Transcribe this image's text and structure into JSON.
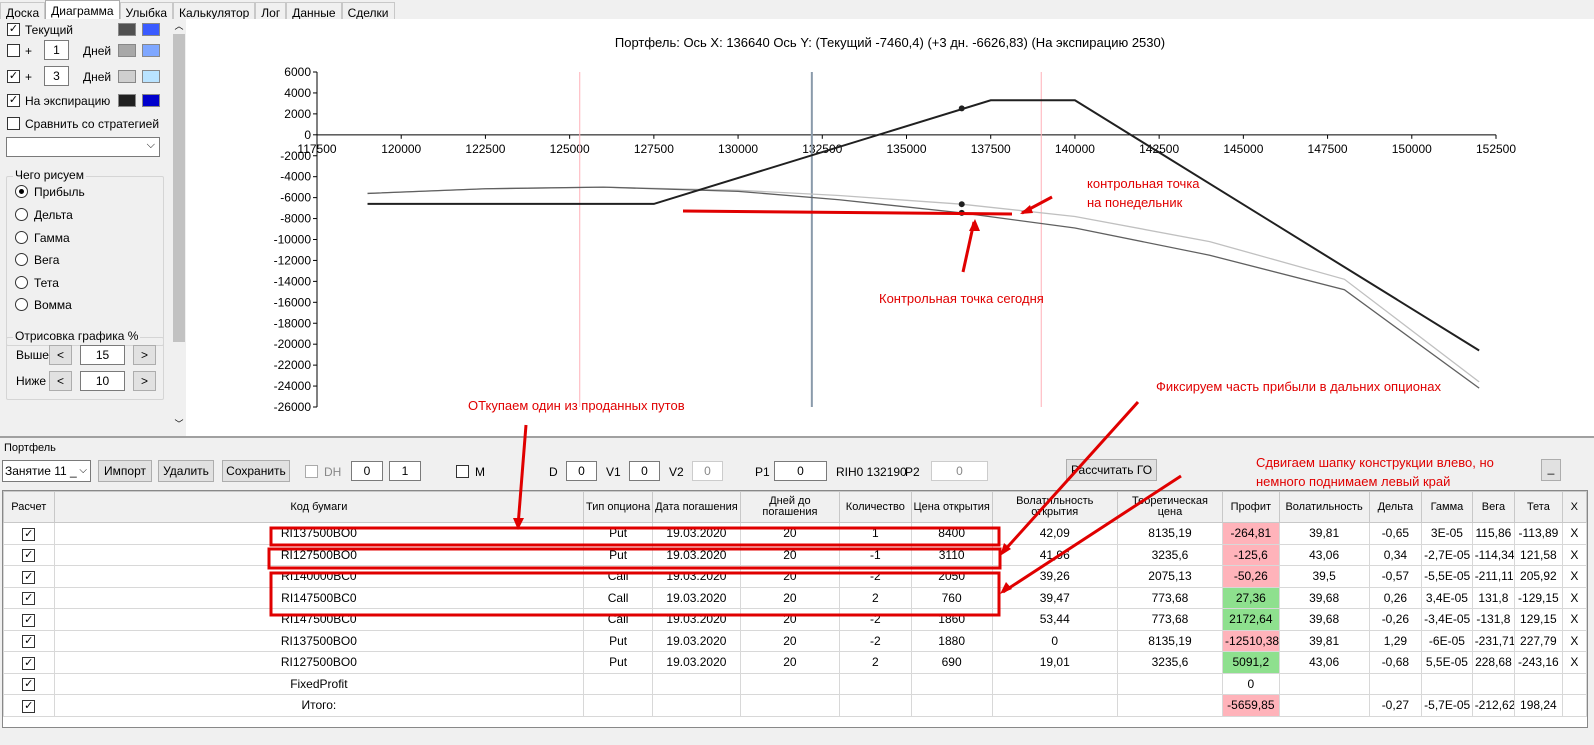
{
  "tabs": [
    "Доска",
    "Диаграмма",
    "Улыбка",
    "Калькулятор",
    "Лог",
    "Данные",
    "Сделки"
  ],
  "left": {
    "current_label": "Текущий",
    "plus1": "+",
    "plus1_days": "1",
    "days1": "Дней",
    "plus2": "+",
    "plus2_days": "3",
    "days2": "Дней",
    "expiry_label": "На экспирацию",
    "compare_label": "Сравнить со стратегией",
    "what_title": "Чего рисуем",
    "radios": [
      "Прибыль",
      "Дельта",
      "Гамма",
      "Вега",
      "Тета",
      "Вомма"
    ],
    "draw_title": "Отрисовка графика %",
    "above_label": "Выше",
    "above_value": "15",
    "below_label": "Ниже",
    "below_value": "10",
    "colors": {
      "current": [
        "#505050",
        "#3a5bff"
      ],
      "plus1": [
        "#a8a8a8",
        "#7fa7ff"
      ],
      "plus3": [
        "#cfcfcf",
        "#b9e3ff"
      ],
      "expiry": [
        "#202020",
        "#0000cc"
      ]
    }
  },
  "chart_data": {
    "type": "line",
    "title": "Портфель: Ось X:  136640 Ось Y:   (Текущий -7460,4)  (+3 дн. -6626,83)  (На экспирацию 2530)",
    "xlim": [
      117500,
      152500
    ],
    "ylim": [
      -26000,
      6000
    ],
    "x_ticks": [
      "117500",
      "120000",
      "122500",
      "125000",
      "127500",
      "130000",
      "132500",
      "135000",
      "137500",
      "140000",
      "142500",
      "145000",
      "147500",
      "150000",
      "152500"
    ],
    "y_ticks": [
      "6000",
      "4000",
      "2000",
      "0",
      "-2000",
      "-4000",
      "-6000",
      "-8000",
      "-10000",
      "-12000",
      "-14000",
      "-16000",
      "-18000",
      "-20000",
      "-22000",
      "-24000",
      "-26000"
    ],
    "vlines": [
      {
        "x": 132190,
        "color": "#8a9aaa"
      },
      {
        "x": 125300,
        "color": "#ffb0b8"
      },
      {
        "x": 139000,
        "color": "#ffb0b8"
      }
    ],
    "series": [
      {
        "color": "#202020",
        "x": [
          119000,
          127500,
          137500,
          140000,
          152000
        ],
        "y": [
          -6600,
          -6600,
          3300,
          3300,
          -20600
        ]
      },
      {
        "color": "#606060",
        "x": [
          119000,
          122500,
          126000,
          130000,
          133000,
          136640,
          140000,
          144000,
          148000,
          152000
        ],
        "y": [
          -5600,
          -5150,
          -5000,
          -5400,
          -6200,
          -7460,
          -8900,
          -11500,
          -14800,
          -24200
        ]
      },
      {
        "color": "#c0c0c0",
        "x": [
          119000,
          122500,
          126000,
          130000,
          133000,
          136640,
          140000,
          144000,
          148000,
          152000
        ],
        "y": [
          -5600,
          -5150,
          -5000,
          -5300,
          -5800,
          -6627,
          -7800,
          -10200,
          -13800,
          -23600
        ]
      }
    ],
    "points": [
      {
        "x": 136640,
        "y": 2530
      },
      {
        "x": 136640,
        "y": -7460
      },
      {
        "x": 136640,
        "y": -6627
      }
    ]
  },
  "toolbar": {
    "portfolio_label": "Портфель",
    "lesson_select": "Занятие 11 _",
    "import": "Импорт",
    "delete": "Удалить",
    "save": "Сохранить",
    "dh": "DH",
    "dh_val1": "0",
    "dh_val2": "1",
    "m": "M",
    "d_label": "D",
    "d_val": "0",
    "v1_label": "V1",
    "v1_val": "0",
    "v2_label": "V2",
    "v2_val": "0",
    "p1_label": "P1",
    "p1_val": "0",
    "rih": "RIH0 132190",
    "p2_label": "P2",
    "p2_val": "0",
    "calc_go": "Рассчитать ГО",
    "minimize": "_"
  },
  "table": {
    "headers": [
      "Расчет",
      "Код бумаги",
      "Тип опциона",
      "Дата погашения",
      "Дней до погашения",
      "Количество",
      "Цена открытия",
      "Волатильность открытия",
      "Теоретическая цена",
      "Профит",
      "Волатильность",
      "Дельта",
      "Гамма",
      "Вега",
      "Тета",
      "X"
    ],
    "rows": [
      {
        "code": "RI137500BO0",
        "type": "Put",
        "date": "19.03.2020",
        "days": "20",
        "qty": "1",
        "price": "8400",
        "vol_open": "42,09",
        "theor": "8135,19",
        "profit": "-264,81",
        "pc": "pink",
        "vol": "39,81",
        "delta": "-0,65",
        "gamma": "3E-05",
        "vega": "115,86",
        "theta": "-113,89",
        "x": "X"
      },
      {
        "code": "RI127500BO0",
        "type": "Put",
        "date": "19.03.2020",
        "days": "20",
        "qty": "-1",
        "price": "3110",
        "vol_open": "41,96",
        "theor": "3235,6",
        "profit": "-125,6",
        "pc": "pink",
        "vol": "43,06",
        "delta": "0,34",
        "gamma": "-2,7E-05",
        "vega": "-114,34",
        "theta": "121,58",
        "x": "X"
      },
      {
        "code": "RI140000BC0",
        "type": "Call",
        "date": "19.03.2020",
        "days": "20",
        "qty": "-2",
        "price": "2050",
        "vol_open": "39,26",
        "theor": "2075,13",
        "profit": "-50,26",
        "pc": "pink",
        "vol": "39,5",
        "delta": "-0,57",
        "gamma": "-5,5E-05",
        "vega": "-211,11",
        "theta": "205,92",
        "x": "X"
      },
      {
        "code": "RI147500BC0",
        "type": "Call",
        "date": "19.03.2020",
        "days": "20",
        "qty": "2",
        "price": "760",
        "vol_open": "39,47",
        "theor": "773,68",
        "profit": "27,36",
        "pc": "green",
        "vol": "39,68",
        "delta": "0,26",
        "gamma": "3,4E-05",
        "vega": "131,8",
        "theta": "-129,15",
        "x": "X"
      },
      {
        "code": "RI147500BC0",
        "type": "Call",
        "date": "19.03.2020",
        "days": "20",
        "qty": "-2",
        "price": "1860",
        "vol_open": "53,44",
        "theor": "773,68",
        "profit": "2172,64",
        "pc": "green",
        "vol": "39,68",
        "delta": "-0,26",
        "gamma": "-3,4E-05",
        "vega": "-131,8",
        "theta": "129,15",
        "x": "X"
      },
      {
        "code": "RI137500BO0",
        "type": "Put",
        "date": "19.03.2020",
        "days": "20",
        "qty": "-2",
        "price": "1880",
        "vol_open": "0",
        "theor": "8135,19",
        "profit": "-12510,38",
        "pc": "pink",
        "vol": "39,81",
        "delta": "1,29",
        "gamma": "-6E-05",
        "vega": "-231,71",
        "theta": "227,79",
        "x": "X"
      },
      {
        "code": "RI127500BO0",
        "type": "Put",
        "date": "19.03.2020",
        "days": "20",
        "qty": "2",
        "price": "690",
        "vol_open": "19,01",
        "theor": "3235,6",
        "profit": "5091,2",
        "pc": "green",
        "vol": "43,06",
        "delta": "-0,68",
        "gamma": "5,5E-05",
        "vega": "228,68",
        "theta": "-243,16",
        "x": "X"
      },
      {
        "code": "FixedProfit",
        "type": "",
        "date": "",
        "days": "",
        "qty": "",
        "price": "",
        "vol_open": "",
        "theor": "",
        "profit": "0",
        "pc": "",
        "vol": "",
        "delta": "",
        "gamma": "",
        "vega": "",
        "theta": "",
        "x": ""
      },
      {
        "code": "Итого:",
        "type": "",
        "date": "",
        "days": "",
        "qty": "",
        "price": "",
        "vol_open": "",
        "theor": "",
        "profit": "-5659,85",
        "pc": "pink",
        "vol": "",
        "delta": "-0,27",
        "gamma": "-5,7E-05",
        "vega": "-212,62",
        "theta": "198,24",
        "x": ""
      }
    ]
  },
  "annotations": {
    "monday1": "контрольная точка",
    "monday2": "на понедельник",
    "today": "Контрольная точка сегодня",
    "buyback": "ОТкупаем один из проданных путов",
    "fix": "Фиксируем часть прибыли в дальних опционах",
    "shift1": "Сдвигаем шапку конструкции влево, но",
    "shift2": "немного поднимаем левый край"
  }
}
